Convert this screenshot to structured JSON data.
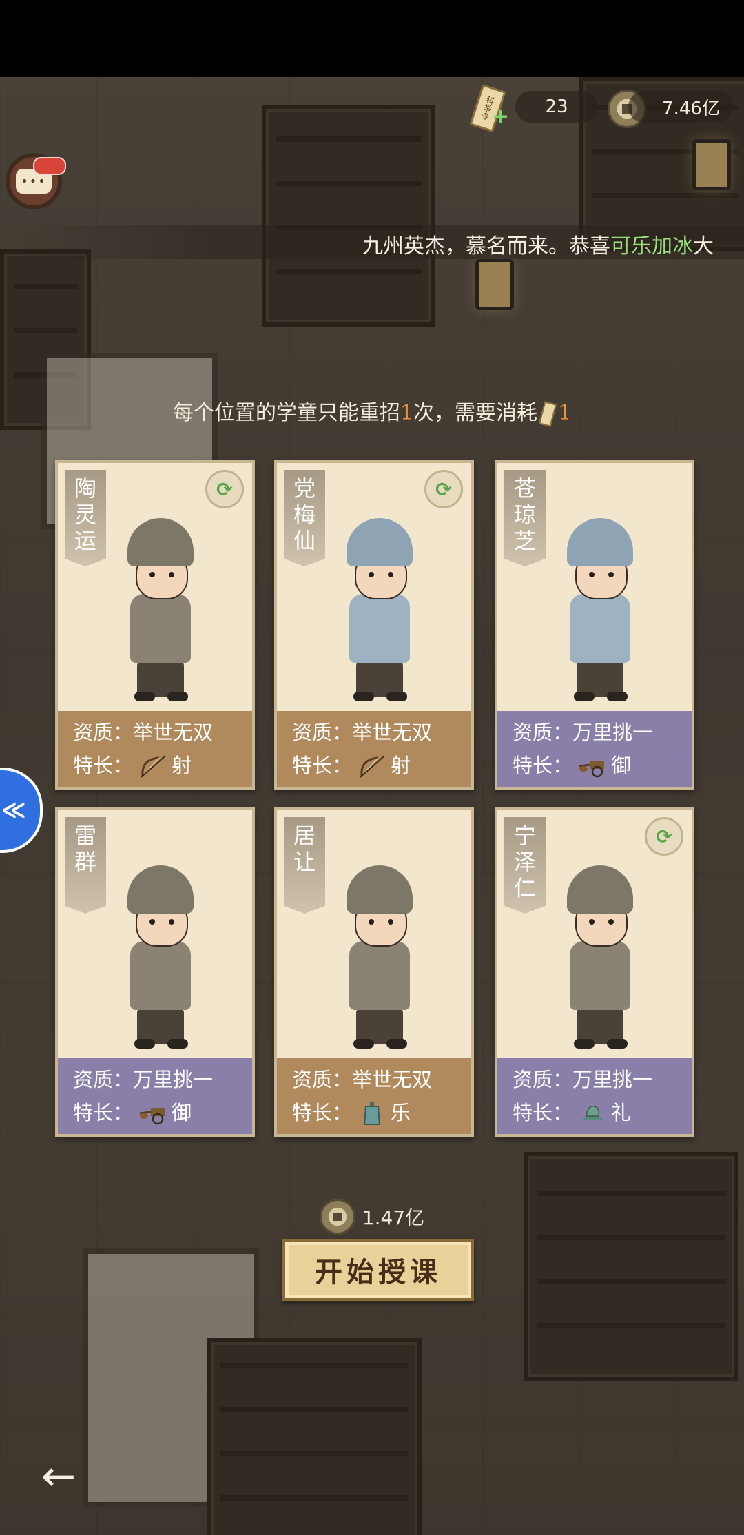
{
  "resources": {
    "token_count": "23",
    "coins": "7.46亿",
    "token_label": "科举令"
  },
  "chat": {
    "icon_text": "•••"
  },
  "marquee": {
    "prefix": "九州英杰，慕名而来。恭喜",
    "highlight": "可乐加冰",
    "suffix": "大"
  },
  "notice": {
    "prefix": "每个位置的学童只能重招",
    "count": "1",
    "middle": "次，需要消耗",
    "cost": "1"
  },
  "labels": {
    "quality": "资质：",
    "specialty": "特长："
  },
  "cards": [
    {
      "name": "陶灵运",
      "quality": "举世无双",
      "skill": "射",
      "skill_icon": "bow-icon",
      "tier": "gold",
      "refresh": true
    },
    {
      "name": "党梅仙",
      "quality": "举世无双",
      "skill": "射",
      "skill_icon": "bow-icon",
      "tier": "gold",
      "refresh": true
    },
    {
      "name": "苍琼芝",
      "quality": "万里挑一",
      "skill": "御",
      "skill_icon": "chariot-icon",
      "tier": "purple",
      "refresh": false
    },
    {
      "name": "雷群",
      "quality": "万里挑一",
      "skill": "御",
      "skill_icon": "chariot-icon",
      "tier": "purple",
      "refresh": false
    },
    {
      "name": "居让",
      "quality": "举世无双",
      "skill": "乐",
      "skill_icon": "bell-icon",
      "tier": "gold",
      "refresh": false
    },
    {
      "name": "宁泽仁",
      "quality": "万里挑一",
      "skill": "礼",
      "skill_icon": "hat-icon",
      "tier": "purple",
      "refresh": true
    }
  ],
  "footer": {
    "cost": "1.47亿",
    "start_label": "开始授课",
    "side_icon": "≪"
  },
  "colors": {
    "gold": "#b08a5c",
    "purple": "#8a7fa8",
    "highlight_green": "#9be07f",
    "highlight_orange": "#f0923a"
  }
}
